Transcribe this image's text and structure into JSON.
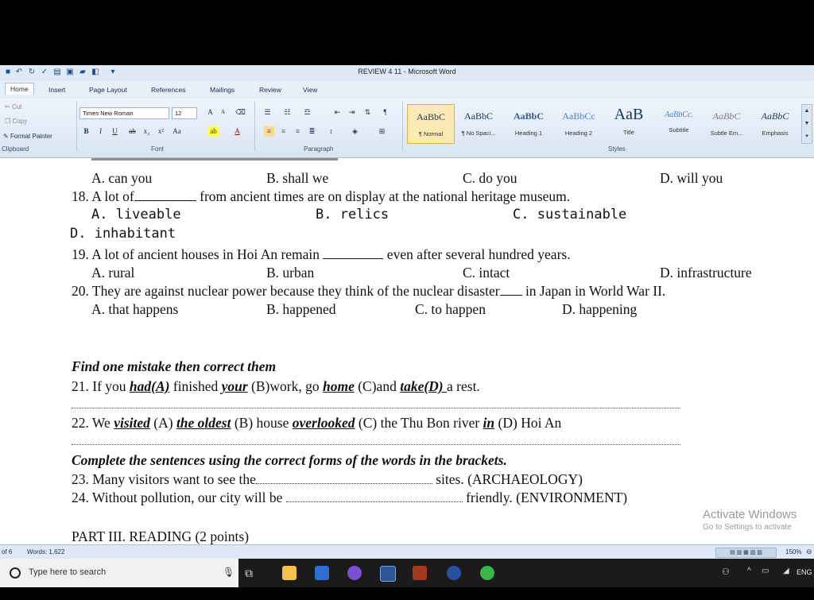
{
  "window": {
    "title": "REVIEW 4 11 - Microsoft Word"
  },
  "tabs": [
    "Home",
    "Insert",
    "Page Layout",
    "References",
    "Mailings",
    "Review",
    "View"
  ],
  "ribbon": {
    "clipboard": {
      "cut": "Cut",
      "copy": "Copy",
      "format_painter": "Format Painter",
      "group": "Clipboard"
    },
    "font": {
      "name": "Times New Roman",
      "size": "12",
      "group": "Font"
    },
    "paragraph": {
      "group": "Paragraph"
    },
    "styles": {
      "group": "Styles",
      "items": [
        {
          "sample": "AaBbC",
          "name": "¶ Normal"
        },
        {
          "sample": "AaBbC",
          "name": "¶ No Spaci..."
        },
        {
          "sample": "AaBbC",
          "name": "Heading 1"
        },
        {
          "sample": "AaBbCc",
          "name": "Heading 2"
        },
        {
          "sample": "AaB",
          "name": "Title"
        },
        {
          "sample": "AaBbCc.",
          "name": "Subtitle"
        },
        {
          "sample": "AaBbC",
          "name": "Subtle Em..."
        },
        {
          "sample": "AaBbC",
          "name": "Emphasis"
        }
      ]
    }
  },
  "document": {
    "q17_options": {
      "a": "A. can you",
      "b": "B. shall we",
      "c": "C. do you",
      "d": "D. will you"
    },
    "q18": {
      "pre": "18. A lot of",
      "post": "from ancient times are on display at the national heritage museum.",
      "a": "A. liveable",
      "b": "B. relics",
      "c": "C. sustainable",
      "d": "D. inhabitant"
    },
    "q19": {
      "pre": "19. A lot of ancient houses in Hoi An remain",
      "post": "even after several hundred years.",
      "a": "A. rural",
      "b": "B. urban",
      "c": "C. intact",
      "d": "D. infrastructure"
    },
    "q20": {
      "pre": "20. They are against nuclear power because they think of the nuclear disaster",
      "post": "in Japan in World War II.",
      "a": "A. that happens",
      "b": "B. happened",
      "c": "C. to happen",
      "d": "D. happening"
    },
    "section_mistake": "Find one mistake then correct them",
    "q21": {
      "p1": "21. If you ",
      "u1": "had(A)",
      "p2": " finished ",
      "u2": "your",
      "p3": " (B)work, go ",
      "u3": "home",
      "p4": " (C)and ",
      "u4": "take(D) ",
      "p5": "a rest."
    },
    "q22": {
      "p1": "22. We ",
      "u1": "visited",
      "p2": " (A) ",
      "u2": "the oldest",
      "p3": " (B)  house ",
      "u3": "overlooked",
      "p4": " (C) the Thu Bon river ",
      "u4": "in",
      "p5": " (D) Hoi An"
    },
    "section_forms": "Complete the sentences using the correct forms of the words in the brackets.",
    "q23": {
      "pre": "23. Many visitors want to see the",
      "post": "sites. (ARCHAEOLOGY)"
    },
    "q24": {
      "pre": "24. Without pollution, our city will be",
      "post": "friendly. (ENVIRONMENT)"
    },
    "part3": "PART III. READING (2 points)"
  },
  "watermark": {
    "line1": "Activate Windows",
    "line2": "Go to Settings to activate"
  },
  "status": {
    "page": "of 6",
    "words": "Words: 1,622",
    "zoom": "150%"
  },
  "taskbar": {
    "search_placeholder": "Type here to search",
    "lang": "ENG"
  }
}
